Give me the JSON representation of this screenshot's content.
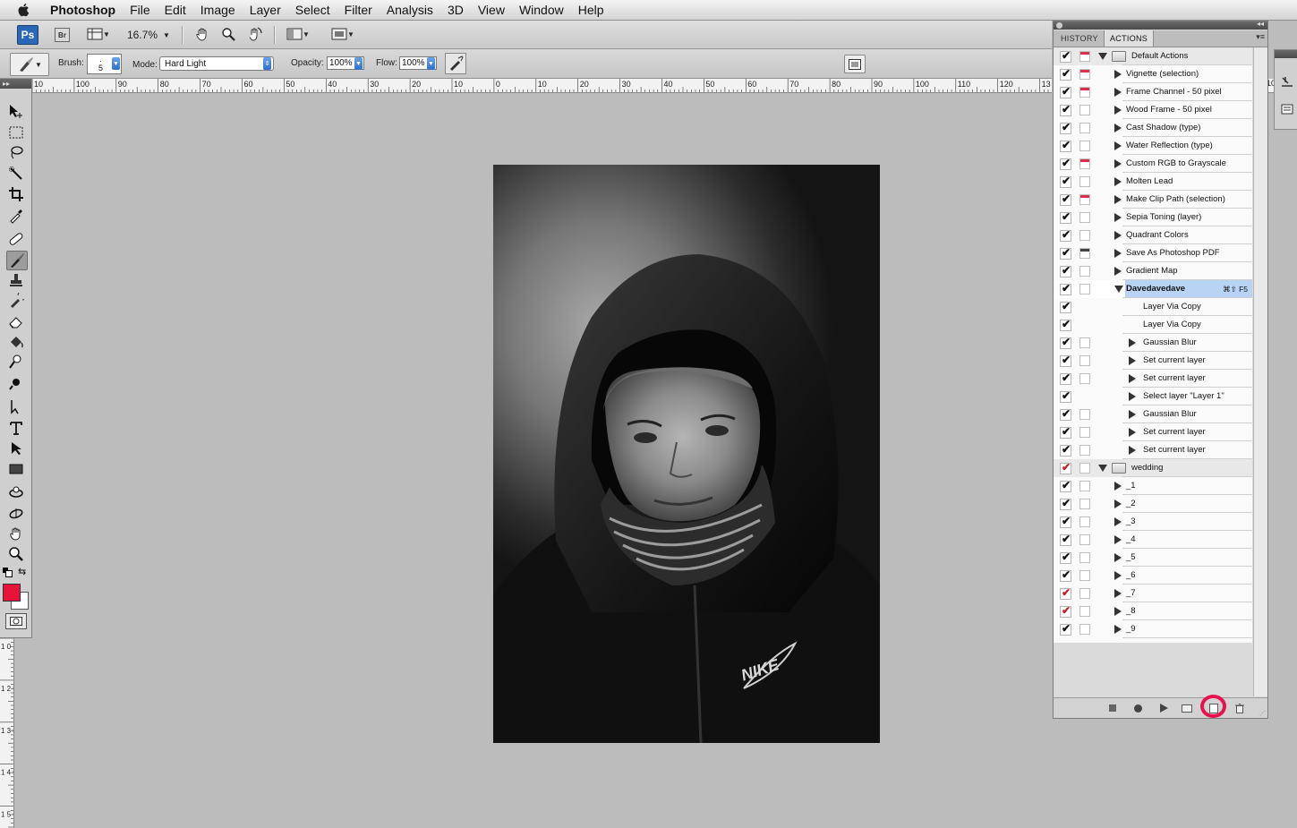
{
  "menubar": {
    "app_name": "Photoshop",
    "items": [
      "File",
      "Edit",
      "Image",
      "Layer",
      "Select",
      "Filter",
      "Analysis",
      "3D",
      "View",
      "Window",
      "Help"
    ]
  },
  "appbar": {
    "ps_logo": "Ps",
    "bridge_label": "Br",
    "zoom": "16.7%"
  },
  "options": {
    "brush_label": "Brush:",
    "brush_size": "5",
    "mode_label": "Mode:",
    "mode_value": "Hard Light",
    "opacity_label": "Opacity:",
    "opacity_value": "100%",
    "flow_label": "Flow:",
    "flow_value": "100%"
  },
  "ruler": {
    "h_labels": [
      "10",
      "100",
      "90",
      "80",
      "70",
      "60",
      "50",
      "40",
      "30",
      "20",
      "10",
      "0",
      "10",
      "20",
      "30",
      "40",
      "50",
      "60",
      "70",
      "80",
      "90",
      "100",
      "110",
      "120",
      "13"
    ],
    "h_right": "10",
    "v_labels": [
      "1 0",
      "1 2 0",
      "1 3 0",
      "1 4 0",
      "1 5 0"
    ]
  },
  "colors": {
    "foreground": "#e8133a",
    "background": "#ffffff",
    "highlight_circle": "#e7124f",
    "selection": "#b9d3f5"
  },
  "panel": {
    "tabs": [
      "HISTORY",
      "ACTIONS"
    ],
    "active_tab": "ACTIONS",
    "rows": [
      {
        "name": "Default Actions",
        "type": "set",
        "expanded": true,
        "check": "black",
        "dialog": "red"
      },
      {
        "name": "Vignette (selection)",
        "type": "action",
        "check": "black",
        "dialog": "red"
      },
      {
        "name": "Frame Channel - 50 pixel",
        "type": "action",
        "check": "black",
        "dialog": "red"
      },
      {
        "name": "Wood Frame - 50 pixel",
        "type": "action",
        "check": "black",
        "dialog": "none"
      },
      {
        "name": "Cast Shadow (type)",
        "type": "action",
        "check": "black",
        "dialog": "none"
      },
      {
        "name": "Water Reflection (type)",
        "type": "action",
        "check": "black",
        "dialog": "none"
      },
      {
        "name": "Custom RGB to Grayscale",
        "type": "action",
        "check": "black",
        "dialog": "red"
      },
      {
        "name": "Molten Lead",
        "type": "action",
        "check": "black",
        "dialog": "none"
      },
      {
        "name": "Make Clip Path (selection)",
        "type": "action",
        "check": "black",
        "dialog": "red"
      },
      {
        "name": "Sepia Toning (layer)",
        "type": "action",
        "check": "black",
        "dialog": "none"
      },
      {
        "name": "Quadrant Colors",
        "type": "action",
        "check": "black",
        "dialog": "none"
      },
      {
        "name": "Save As Photoshop PDF",
        "type": "action",
        "check": "black",
        "dialog": "black"
      },
      {
        "name": "Gradient Map",
        "type": "action",
        "check": "black",
        "dialog": "none"
      },
      {
        "name": "Davedavedave",
        "type": "action",
        "expanded": true,
        "selected": true,
        "check": "black",
        "dialog": "none",
        "shortcut": "⌘⇧ F5"
      },
      {
        "name": "Layer Via Copy",
        "type": "step",
        "check": "black",
        "dialog": "hidden"
      },
      {
        "name": "Layer Via Copy",
        "type": "step",
        "check": "black",
        "dialog": "hidden"
      },
      {
        "name": "Gaussian Blur",
        "type": "step",
        "expandable": true,
        "check": "black",
        "dialog": "none"
      },
      {
        "name": "Set current layer",
        "type": "step",
        "expandable": true,
        "check": "black",
        "dialog": "none"
      },
      {
        "name": "Set current layer",
        "type": "step",
        "expandable": true,
        "check": "black",
        "dialog": "none"
      },
      {
        "name": "Select layer \"Layer 1\"",
        "type": "step",
        "expandable": true,
        "check": "black",
        "dialog": "hidden"
      },
      {
        "name": "Gaussian Blur",
        "type": "step",
        "expandable": true,
        "check": "black",
        "dialog": "none"
      },
      {
        "name": "Set current layer",
        "type": "step",
        "expandable": true,
        "check": "black",
        "dialog": "none"
      },
      {
        "name": "Set current layer",
        "type": "step",
        "expandable": true,
        "check": "black",
        "dialog": "none"
      },
      {
        "name": "wedding",
        "type": "set",
        "expanded": true,
        "check": "red",
        "dialog": "none"
      },
      {
        "name": "_1",
        "type": "action",
        "check": "black",
        "dialog": "none"
      },
      {
        "name": "_2",
        "type": "action",
        "check": "black",
        "dialog": "none"
      },
      {
        "name": "_3",
        "type": "action",
        "check": "black",
        "dialog": "none"
      },
      {
        "name": "_4",
        "type": "action",
        "check": "black",
        "dialog": "none"
      },
      {
        "name": "_5",
        "type": "action",
        "check": "black",
        "dialog": "none"
      },
      {
        "name": "_6",
        "type": "action",
        "check": "black",
        "dialog": "none"
      },
      {
        "name": "_7",
        "type": "action",
        "check": "red",
        "dialog": "none"
      },
      {
        "name": "_8",
        "type": "action",
        "check": "red",
        "dialog": "none"
      },
      {
        "name": "_9",
        "type": "action",
        "check": "black",
        "dialog": "none"
      }
    ],
    "footer_buttons": [
      "stop-icon",
      "record-icon",
      "play-icon",
      "new-set-icon",
      "new-action-icon",
      "trash-icon"
    ]
  },
  "canvas": {
    "logo_text": "NIKE"
  }
}
